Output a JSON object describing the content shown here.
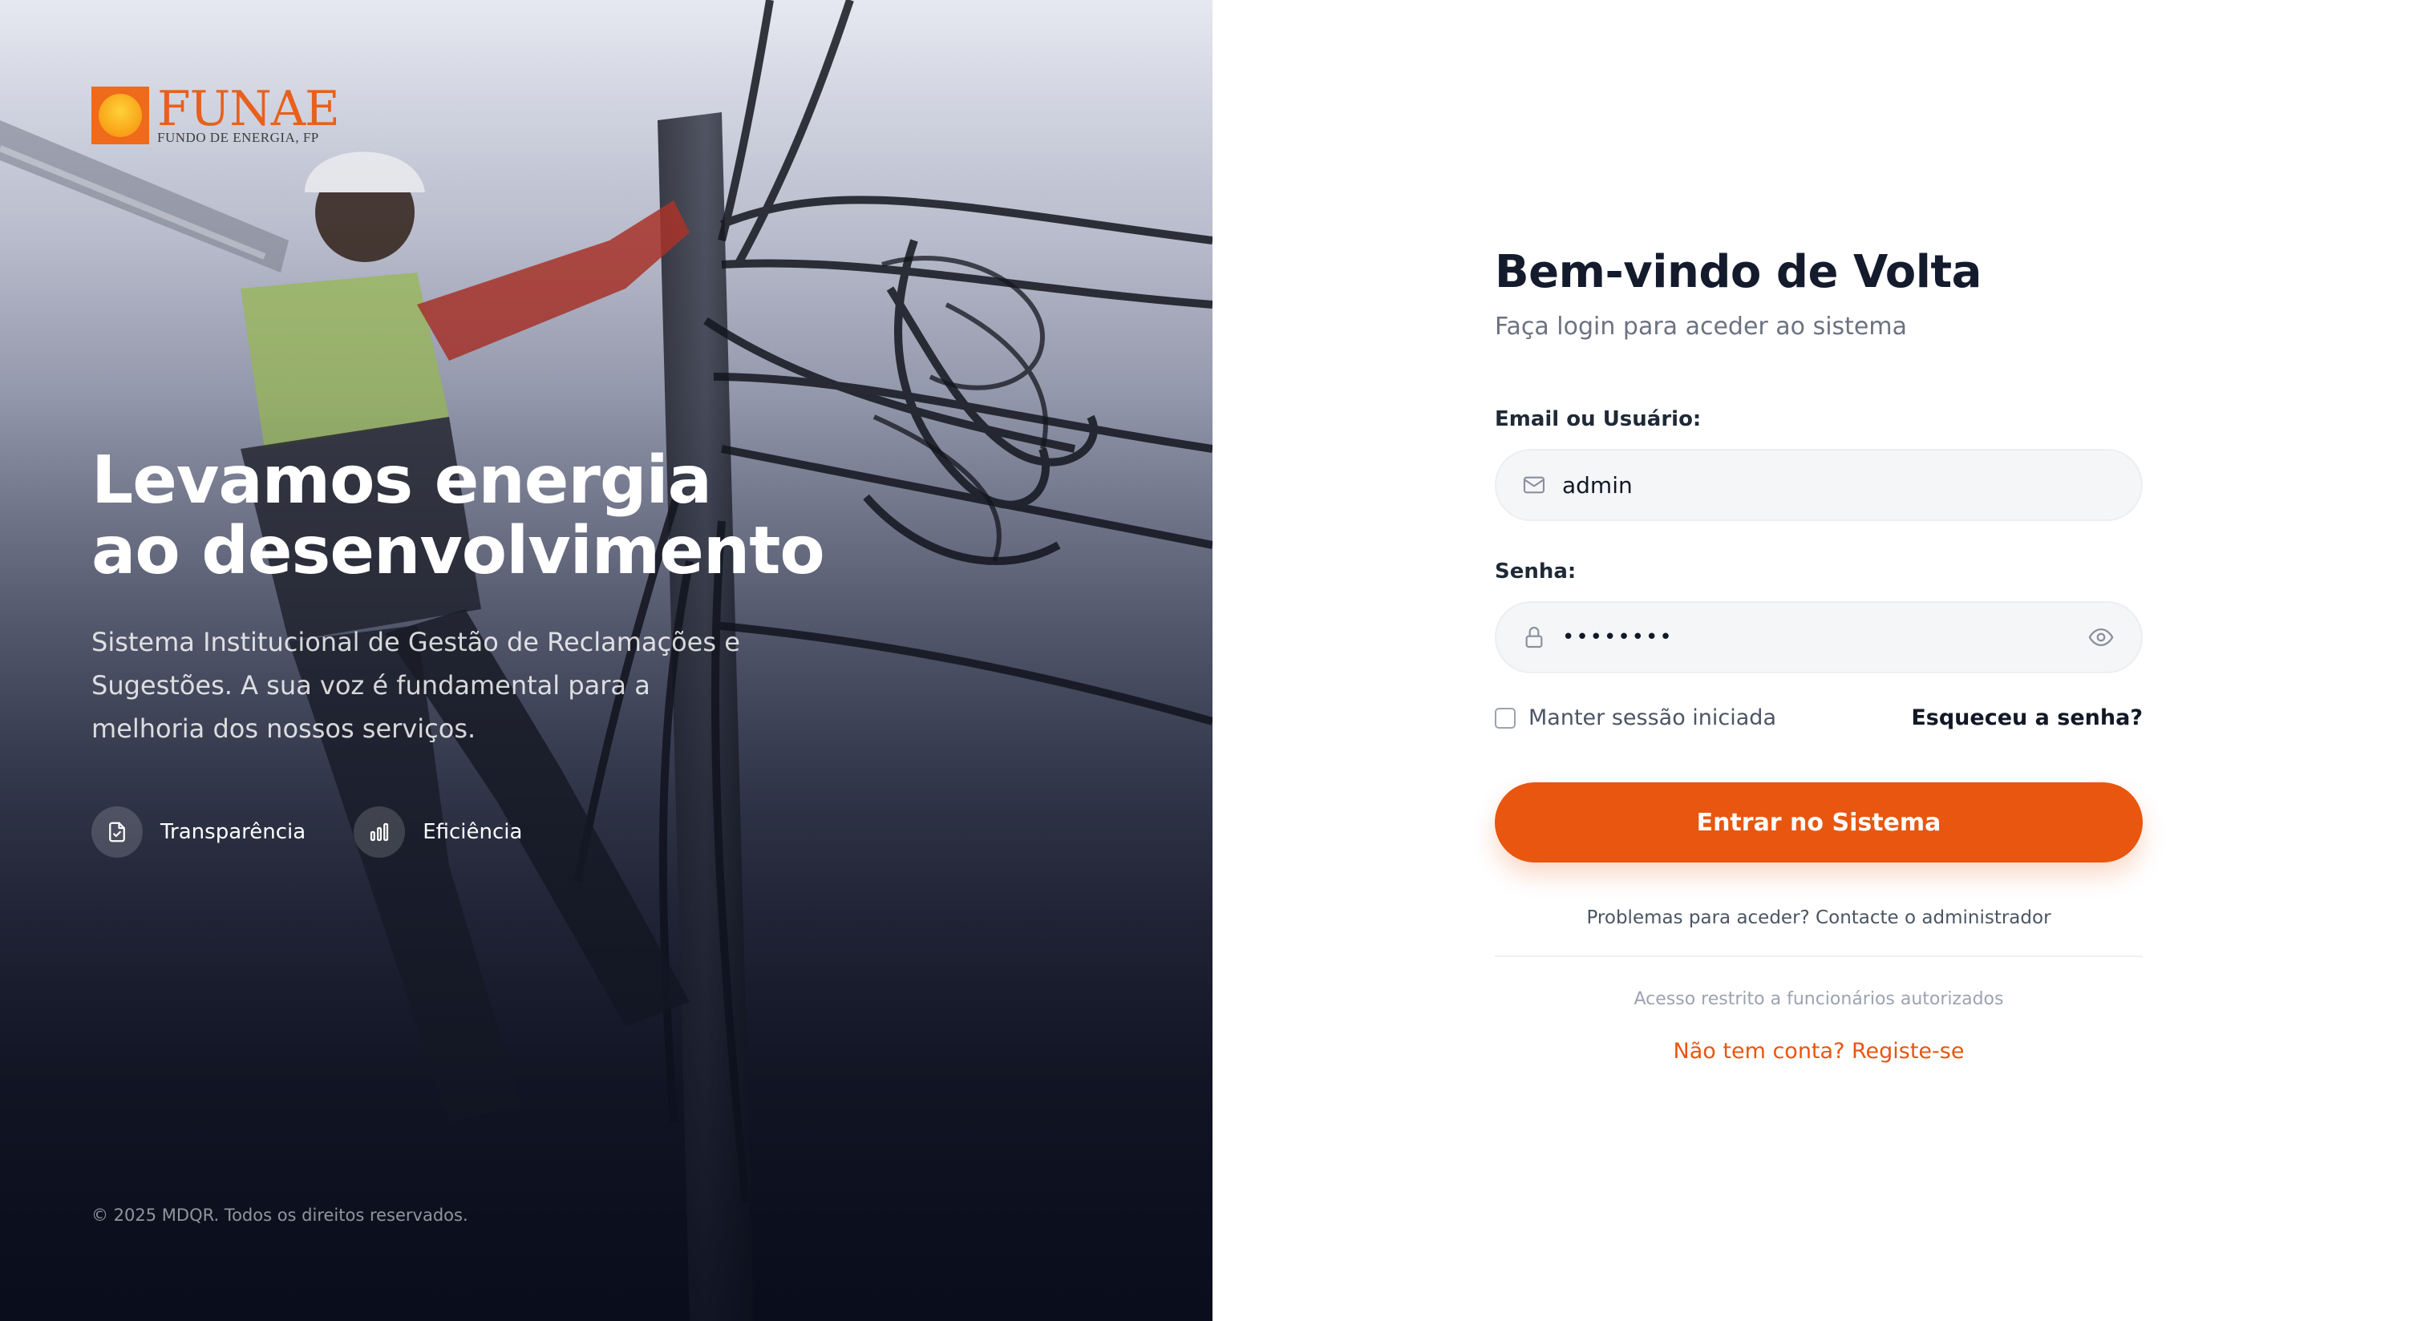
{
  "brand": {
    "name": "FUNAE",
    "subtitle": "FUNDO DE ENERGIA, FP",
    "logo_color": "#ef6a1a"
  },
  "hero": {
    "title_line1": "Levamos energia",
    "title_line2": "ao desenvolvimento",
    "description": "Sistema Institucional de Gestão de Reclamações e Sugestões. A sua voz é fundamental para a melhoria dos nossos serviços.",
    "features": [
      {
        "label": "Transparência",
        "icon": "document-check-icon"
      },
      {
        "label": "Eficiência",
        "icon": "bar-chart-icon"
      }
    ],
    "copyright": "© 2025 MDQR. Todos os direitos reservados."
  },
  "login": {
    "title": "Bem-vindo de Volta",
    "subtitle": "Faça login para aceder ao sistema",
    "email_label": "Email ou Usuário:",
    "email_value": "admin",
    "email_icon": "mail-icon",
    "password_label": "Senha:",
    "password_value": "••••••••",
    "password_icon": "lock-icon",
    "toggle_icon": "eye-icon",
    "remember_label": "Manter sessão iniciada",
    "forgot_label": "Esqueceu a senha?",
    "submit_label": "Entrar no Sistema",
    "help_text": "Problemas para aceder? Contacte o administrador",
    "restricted_text": "Acesso restrito a funcionários autorizados",
    "register_link": "Não tem conta? Registe-se"
  },
  "colors": {
    "accent": "#e8560f",
    "title": "#141b2d",
    "muted": "#6b7280"
  }
}
